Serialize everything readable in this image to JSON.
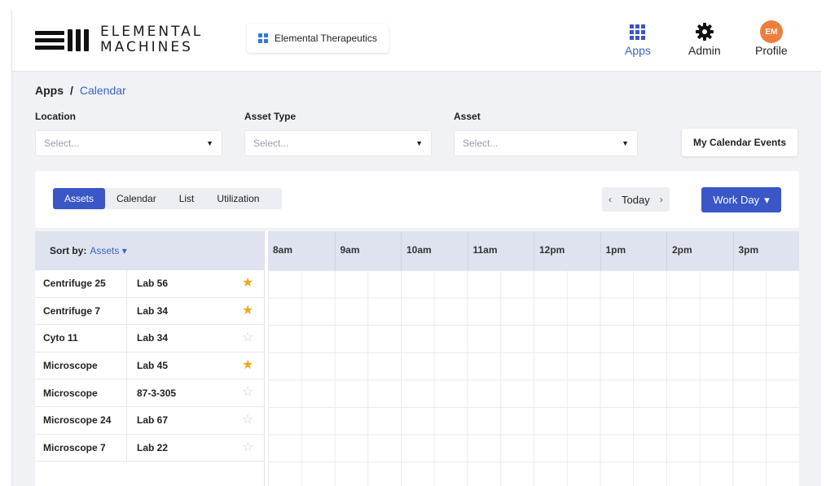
{
  "brand": {
    "logo_line1": "ELEMENTAL",
    "logo_line2": "MACHINES",
    "org_name": "Elemental Therapeutics"
  },
  "nav": [
    {
      "label": "Apps",
      "icon": "grid-icon"
    },
    {
      "label": "Admin",
      "icon": "gear-icon"
    },
    {
      "label": "Profile",
      "icon": "avatar",
      "initials": "EM"
    }
  ],
  "breadcrumb": {
    "root": "Apps",
    "separator": "/",
    "current": "Calendar"
  },
  "filters": [
    {
      "label": "Location",
      "placeholder": "Select..."
    },
    {
      "label": "Asset Type",
      "placeholder": "Select..."
    },
    {
      "label": "Asset",
      "placeholder": "Select..."
    }
  ],
  "my_calendar_events": "My Calendar Events",
  "view_tabs": [
    {
      "label": "Assets",
      "active": true
    },
    {
      "label": "Calendar",
      "active": false
    },
    {
      "label": "List",
      "active": false
    },
    {
      "label": "Utilization",
      "active": false
    }
  ],
  "day_nav": {
    "prev": "‹",
    "today": "Today",
    "next": "›"
  },
  "range_select": {
    "label": "Work Day",
    "caret": "▾"
  },
  "sort": {
    "label": "Sort by:",
    "value": "Assets",
    "caret": "▾"
  },
  "hours": [
    "8am",
    "9am",
    "10am",
    "11am",
    "12pm",
    "1pm",
    "2pm",
    "3pm"
  ],
  "assets": [
    {
      "name": "Centrifuge 25",
      "location": "Lab 56",
      "favorite": true
    },
    {
      "name": "Centrifuge 7",
      "location": "Lab 34",
      "favorite": true
    },
    {
      "name": "Cyto 11",
      "location": "Lab 34",
      "favorite": false
    },
    {
      "name": "Microscope",
      "location": "Lab 45",
      "favorite": true
    },
    {
      "name": "Microscope",
      "location": "87-3-305",
      "favorite": false
    },
    {
      "name": "Microscope 24",
      "location": "Lab 67",
      "favorite": false
    },
    {
      "name": "Microscope 7",
      "location": "Lab 22",
      "favorite": false
    }
  ],
  "colors": {
    "accent": "#3a56c7",
    "star_on": "#f0a81e",
    "avatar": "#ef7d3c"
  }
}
